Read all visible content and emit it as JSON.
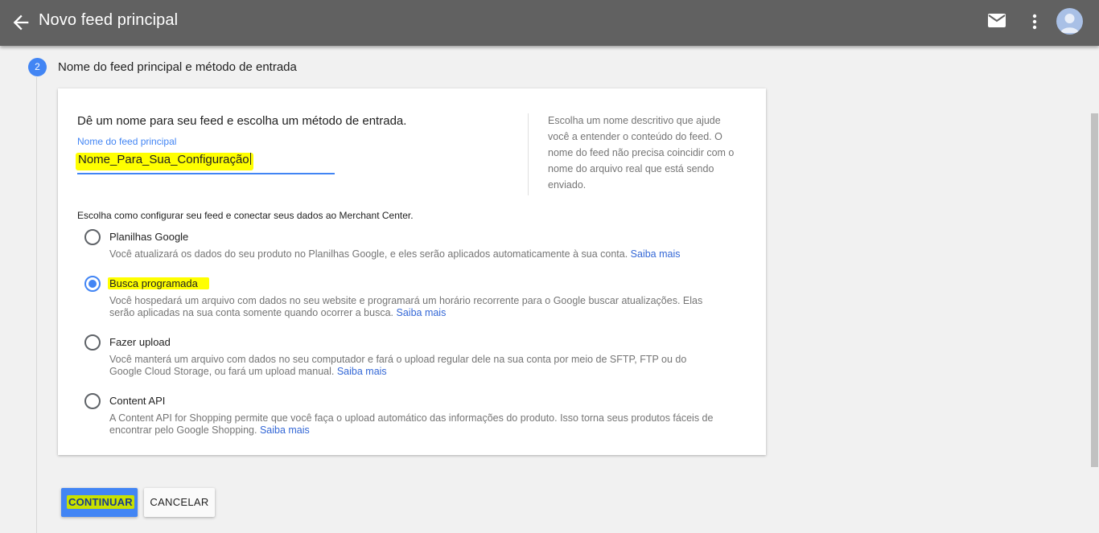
{
  "appbar": {
    "title": "Novo feed principal",
    "back_icon": "arrow-left-icon",
    "mail_icon": "mail-icon",
    "more_icon": "more-vert-icon",
    "avatar_icon": "account-avatar-icon"
  },
  "step": {
    "number": "2",
    "title": "Nome do feed principal e método de entrada"
  },
  "form": {
    "intro": "Dê um nome para seu feed e escolha um método de entrada.",
    "name_label": "Nome do feed principal",
    "name_value": "Nome_Para_Sua_Configuração",
    "help": "Escolha um nome descritivo que ajude você a entender o conteúdo do feed. O nome do feed não precisa coincidir com o nome do arquivo real que está sendo enviado.",
    "method_prompt": "Escolha como configurar seu feed e conectar seus dados ao Merchant Center.",
    "options": [
      {
        "title": "Planilhas Google",
        "description": "Você atualizará os dados do seu produto no Planilhas Google, e eles serão aplicados automaticamente à sua conta.",
        "link": "Saiba mais",
        "selected": false
      },
      {
        "title": "Busca programada",
        "description": "Você hospedará um arquivo com dados no seu website e programará um horário recorrente para o Google buscar atualizações. Elas serão aplicadas na sua conta somente quando ocorrer a busca.",
        "link": "Saiba mais",
        "selected": true
      },
      {
        "title": "Fazer upload",
        "description": "Você manterá um arquivo com dados no seu computador e fará o upload regular dele na sua conta por meio de SFTP, FTP ou do Google Cloud Storage, ou fará um upload manual.",
        "link": "Saiba mais",
        "selected": false
      },
      {
        "title": "Content API",
        "description": "A Content API for Shopping permite que você faça o upload automático das informações do produto. Isso torna seus produtos fáceis de encontrar pelo Google Shopping.",
        "link": "Saiba mais",
        "selected": false
      }
    ]
  },
  "actions": {
    "continue_label": "CONTINUAR",
    "cancel_label": "CANCELAR"
  },
  "colors": {
    "appbar": "#616161",
    "accent": "#4285f4",
    "highlight": "#ffff00",
    "link": "#3367d6"
  }
}
